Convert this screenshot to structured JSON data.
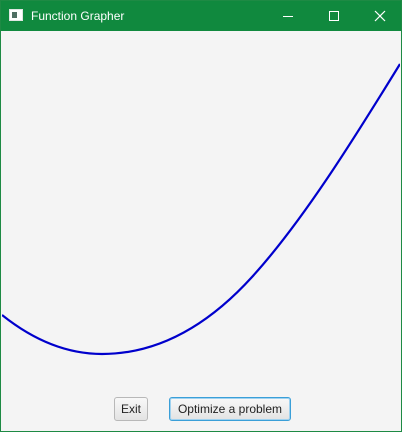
{
  "window": {
    "title": "Function Grapher",
    "accent_color": "#10893e"
  },
  "titlebar_controls": {
    "minimize_icon": "minimize-icon",
    "maximize_icon": "maximize-icon",
    "close_icon": "close-icon"
  },
  "graph": {
    "curve_color": "#0000cc"
  },
  "buttons": {
    "exit_label": "Exit",
    "optimize_label": "Optimize a problem"
  }
}
